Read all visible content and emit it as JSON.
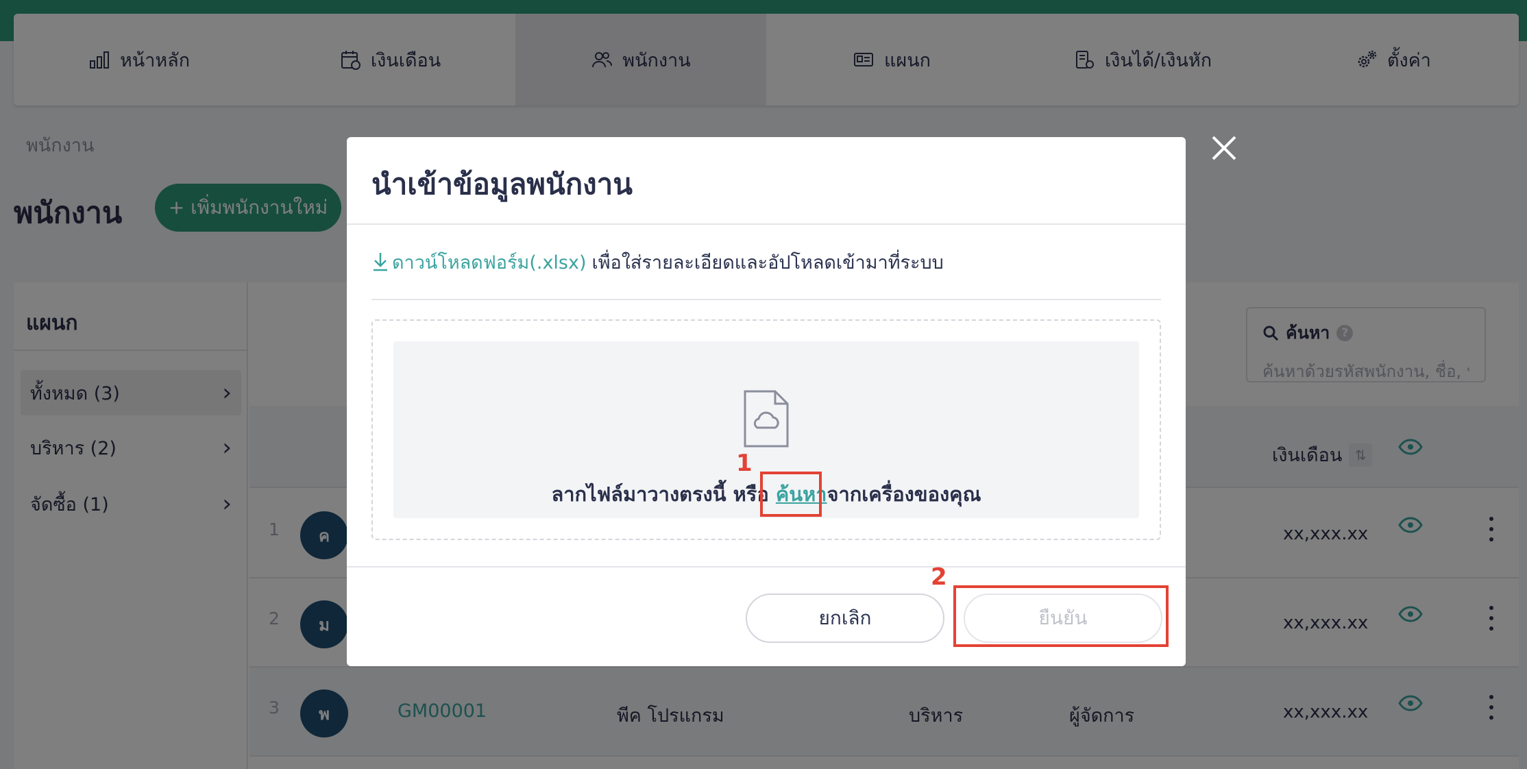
{
  "nav": {
    "tabs": [
      {
        "label": "หน้าหลัก",
        "icon": "bar-chart-icon"
      },
      {
        "label": "เงินเดือน",
        "icon": "calendar-money-icon"
      },
      {
        "label": "พนักงาน",
        "icon": "users-icon"
      },
      {
        "label": "แผนก",
        "icon": "id-card-icon"
      },
      {
        "label": "เงินได้/เงินหัก",
        "icon": "coins-icon"
      },
      {
        "label": "ตั้งค่า",
        "icon": "gears-icon"
      }
    ],
    "active": "พนักงาน"
  },
  "page": {
    "breadcrumb": "พนักงาน",
    "title": "พนักงาน",
    "add_button": "+ เพิ่มพนักงานใหม่"
  },
  "sidebar": {
    "title": "แผนก",
    "items": [
      {
        "label": "ทั้งหมด (3)"
      },
      {
        "label": "บริหาร (2)"
      },
      {
        "label": "จัดซื้อ (1)"
      }
    ]
  },
  "table": {
    "search_label": "ค้นหา",
    "search_help": "?",
    "search_placeholder": "ค้นหาด้วยรหัสพนักงาน, ชื่อ, น",
    "salary_header": "เงินเดือน",
    "rows": [
      {
        "num": "1",
        "avatar": "ค",
        "code": "",
        "name": "",
        "dept": "",
        "position": "",
        "salary": "xx,xxx.xx"
      },
      {
        "num": "2",
        "avatar": "ม",
        "code": "",
        "name": "",
        "dept": "",
        "position": "",
        "salary": "xx,xxx.xx"
      },
      {
        "num": "3",
        "avatar": "พ",
        "code": "GM00001",
        "name": "พีค โปรแกรม",
        "dept": "บริหาร",
        "position": "ผู้จัดการ",
        "salary": "xx,xxx.xx"
      }
    ]
  },
  "modal": {
    "title": "นำเข้าข้อมูลพนักงาน",
    "download_link": "ดาวน์โหลดฟอร์ม(.xlsx)",
    "download_text": "เพื่อใส่รายละเอียดและอัปโหลดเข้ามาที่ระบบ",
    "drop_text_before": "ลากไฟล์มาวางตรงนี้ หรือ",
    "browse_link": "ค้นหา",
    "drop_text_after": "จากเครื่องของคุณ",
    "cancel_button": "ยกเลิก",
    "confirm_button": "ยืนยัน"
  },
  "annotations": {
    "step1": "1",
    "step2": "2",
    "color": "#e34234"
  },
  "colors": {
    "brand": "#2e9a79",
    "link": "#3aa3a0",
    "avatar": "#1f4e73"
  }
}
